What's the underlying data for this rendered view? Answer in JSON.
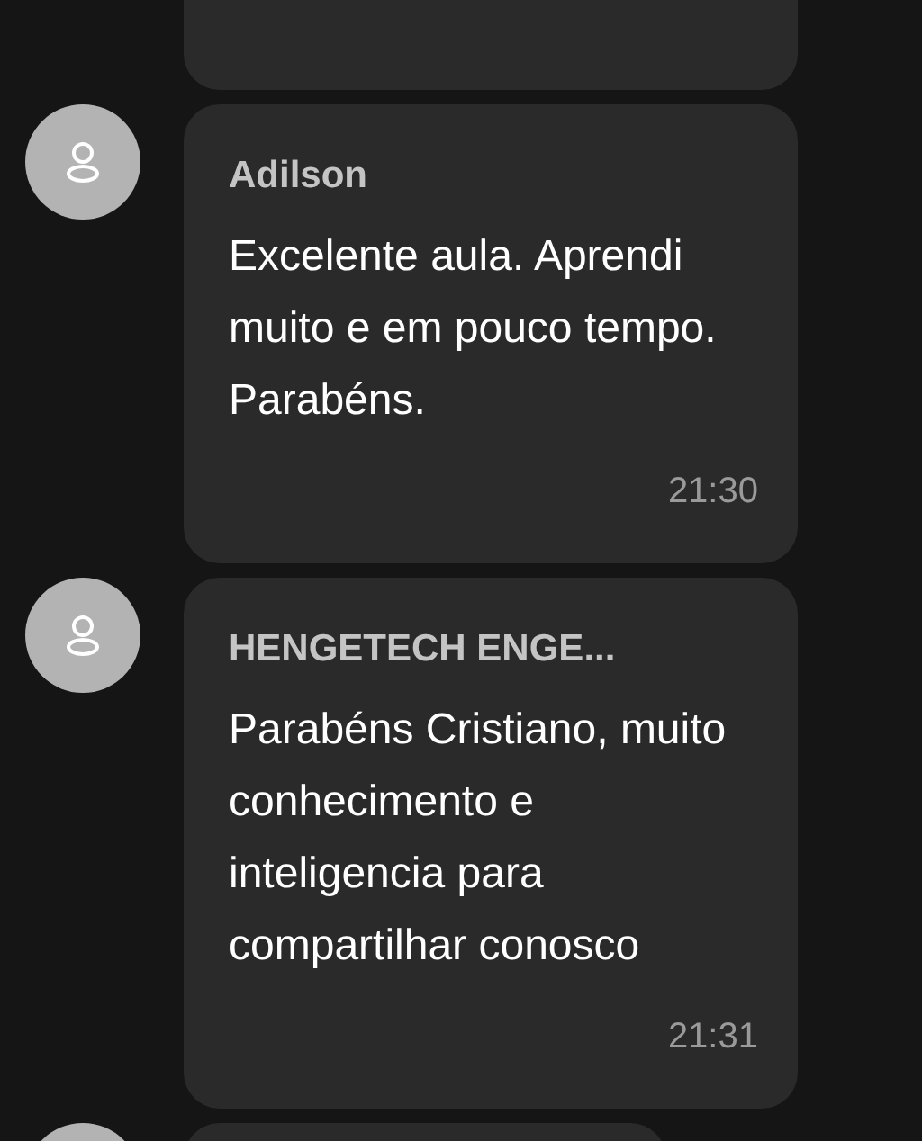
{
  "messages": [
    {
      "author": "Adilson",
      "text": "Excelente aula. Aprendi muito e em pouco tempo. Parabéns.",
      "time": "21:30"
    },
    {
      "author": "HENGETECH ENGE...",
      "text": "Parabéns Cristiano, muito conhecimento e inteligencia para compartilhar conosco",
      "time": "21:31"
    }
  ]
}
